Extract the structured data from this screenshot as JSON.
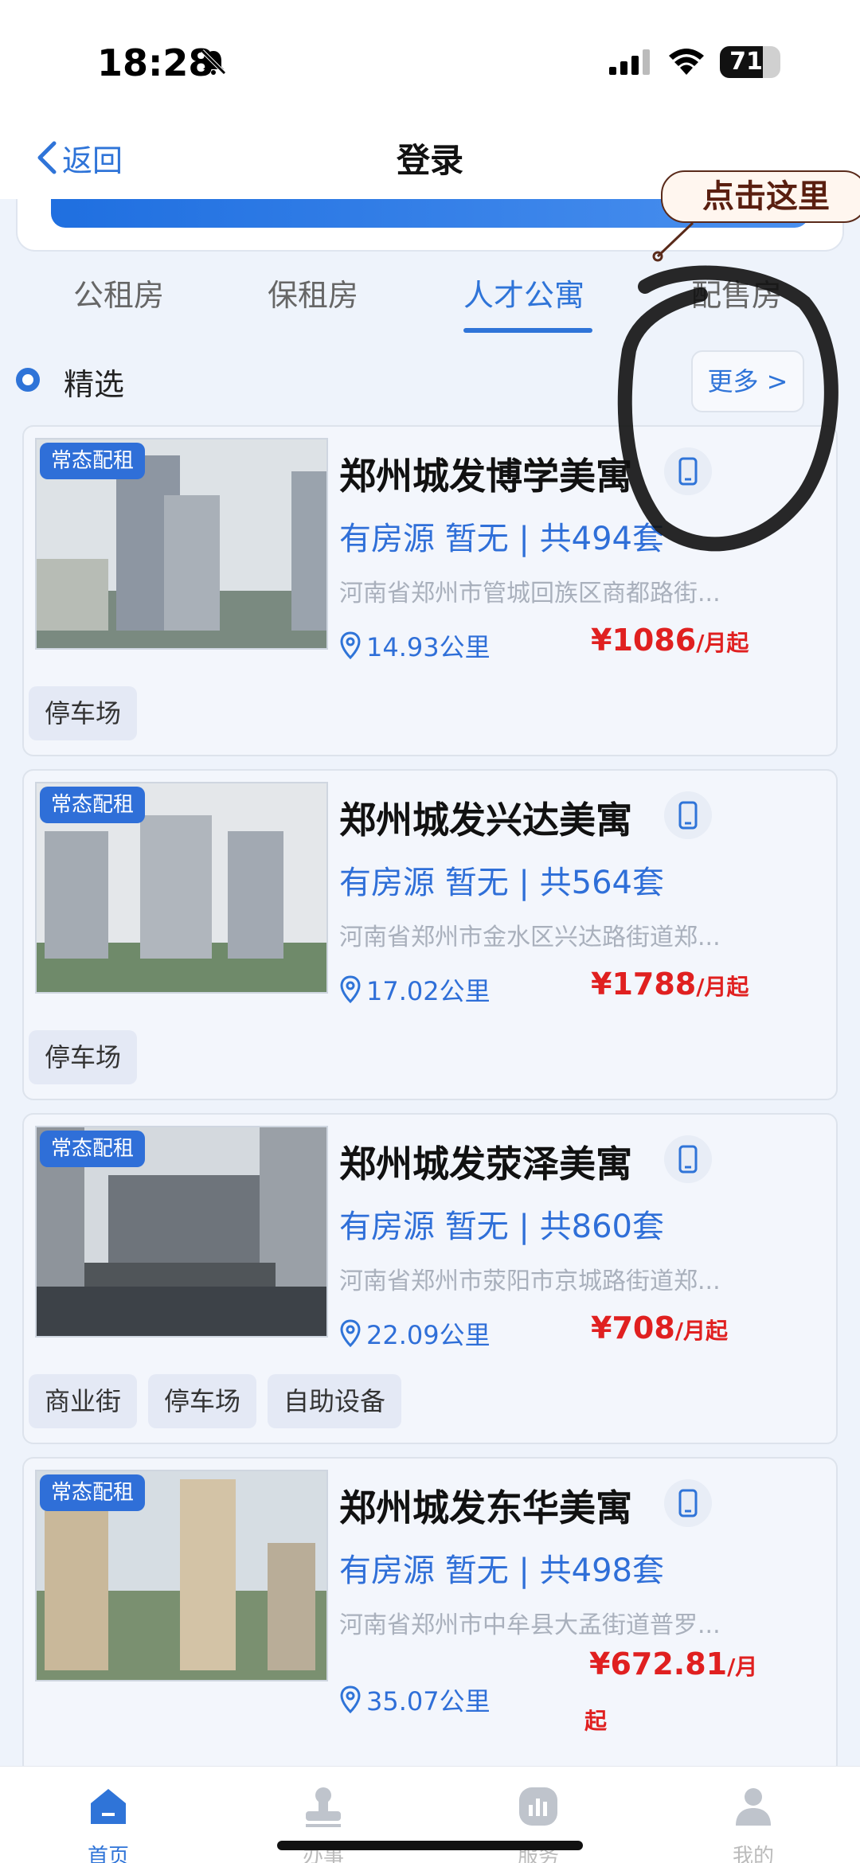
{
  "status_bar": {
    "time": "18:28",
    "battery_text": "71",
    "battery_level": 0.71,
    "icons": [
      "bell-off-icon",
      "signal-icon",
      "wifi-icon",
      "battery-icon"
    ]
  },
  "nav": {
    "back_label": "返回",
    "title": "登录"
  },
  "annotation": {
    "text": "点击这里"
  },
  "tabs": [
    {
      "label": "公租房",
      "active": false
    },
    {
      "label": "保租房",
      "active": false
    },
    {
      "label": "人才公寓",
      "active": true
    },
    {
      "label": "配售房",
      "active": false
    }
  ],
  "section": {
    "title": "精选",
    "more_label": "更多 >"
  },
  "listings": [
    {
      "badge": "常态配租",
      "name": "郑州城发博学美寓",
      "availability": "有房源  暂无 | 共494套",
      "address": "河南省郑州市管城回族区商都路街...",
      "distance": "14.93公里",
      "price": "¥1086",
      "price_unit": "/月起",
      "tags": [
        "停车场"
      ]
    },
    {
      "badge": "常态配租",
      "name": "郑州城发兴达美寓",
      "availability": "有房源  暂无 | 共564套",
      "address": "河南省郑州市金水区兴达路街道郑...",
      "distance": "17.02公里",
      "price": "¥1788",
      "price_unit": "/月起",
      "tags": [
        "停车场"
      ]
    },
    {
      "badge": "常态配租",
      "name": "郑州城发荥泽美寓",
      "availability": "有房源  暂无 | 共860套",
      "address": "河南省郑州市荥阳市京城路街道郑...",
      "distance": "22.09公里",
      "price": "¥708",
      "price_unit": "/月起",
      "tags": [
        "商业街",
        "停车场",
        "自助设备"
      ]
    },
    {
      "badge": "常态配租",
      "name": "郑州城发东华美寓",
      "availability": "有房源  暂无 | 共498套",
      "address": "河南省郑州市中牟县大孟街道普罗...",
      "distance": "35.07公里",
      "price": "¥672.81",
      "price_unit": "/月",
      "price_unit_wrap": "起",
      "tags": []
    }
  ],
  "bottom_nav": [
    {
      "label": "首页",
      "icon": "home-icon",
      "active": true
    },
    {
      "label": "办事",
      "icon": "stamp-icon",
      "active": false
    },
    {
      "label": "服务",
      "icon": "chart-icon",
      "active": false
    },
    {
      "label": "我的",
      "icon": "user-icon",
      "active": false
    }
  ],
  "colors": {
    "accent": "#2f74d8",
    "price": "#e02020",
    "background": "#eef3fb"
  }
}
